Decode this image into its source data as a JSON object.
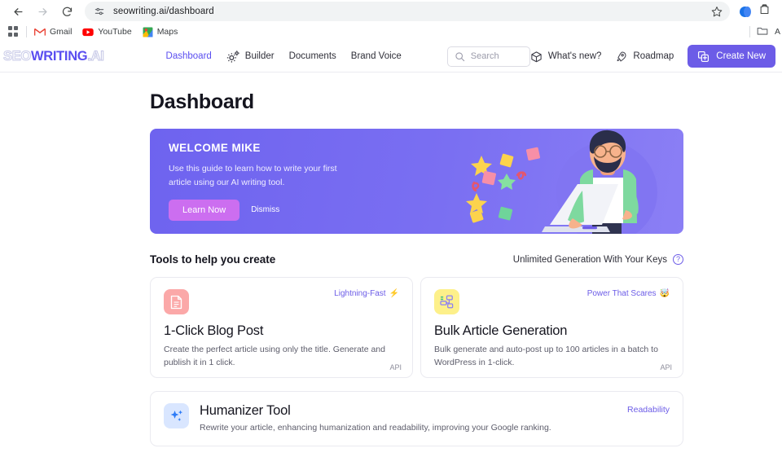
{
  "browser": {
    "url": "seowriting.ai/dashboard",
    "back_icon": "back-arrow-icon",
    "forward_icon": "forward-arrow-icon",
    "reload_icon": "reload-icon",
    "site_settings_icon": "site-settings-icon",
    "star_icon": "bookmark-star-icon",
    "bookmarks": [
      {
        "label": "Gmail",
        "icon": "gmail-icon"
      },
      {
        "label": "YouTube",
        "icon": "youtube-icon"
      },
      {
        "label": "Maps",
        "icon": "maps-icon"
      }
    ]
  },
  "header": {
    "logo": {
      "part1": "SEO",
      "part2": "WRITING",
      "part3": ".AI"
    },
    "nav": [
      {
        "label": "Dashboard",
        "active": true,
        "icon": null
      },
      {
        "label": "Builder",
        "active": false,
        "icon": "gears-icon"
      },
      {
        "label": "Documents",
        "active": false,
        "icon": null
      },
      {
        "label": "Brand Voice",
        "active": false,
        "icon": null
      }
    ],
    "search": {
      "placeholder": "Search",
      "value": "",
      "icon": "search-icon"
    },
    "right_links": [
      {
        "label": "What's new?",
        "icon": "gift-box-icon"
      },
      {
        "label": "Roadmap",
        "icon": "rocket-icon"
      }
    ],
    "create_button": {
      "label": "Create New",
      "icon": "create-new-icon"
    }
  },
  "page": {
    "title": "Dashboard"
  },
  "banner": {
    "title": "WELCOME MIKE",
    "subtitle": "Use this guide to learn how to write your first article using our AI writing tool.",
    "primary_button": "Learn Now",
    "secondary_button": "Dismiss",
    "illustration": "person-with-laptop-illustration",
    "gradient_from": "#6e63ef",
    "gradient_to": "#8b7ff5",
    "primary_button_color": "#cc6ef0"
  },
  "tools": {
    "heading": "Tools to help you create",
    "keys_label": "Unlimited Generation With Your Keys",
    "help_icon": "question-mark-icon",
    "cards": [
      {
        "title": "1-Click Blog Post",
        "description": "Create the perfect article using only the title. Generate and publish it in 1 click.",
        "tag": "Lightning-Fast",
        "tag_emoji": "⚡",
        "footer": "API",
        "icon": "document-icon",
        "icon_bg": "#fba8a8",
        "icon_color": "#ffffff"
      },
      {
        "title": "Bulk Article Generation",
        "description": "Bulk generate and auto-post up to 100 articles in a batch to WordPress in 1-click.",
        "tag": "Power That Scares",
        "tag_emoji": "🤯",
        "footer": "API",
        "icon": "workflow-nodes-icon",
        "icon_bg": "#fdf08a",
        "icon_color": "#8b7ff5"
      }
    ],
    "wide_card": {
      "title": "Humanizer Tool",
      "description": "Rewrite your article, enhancing humanization and readability, improving your Google ranking.",
      "tag": "Readability",
      "icon": "sparkles-icon",
      "icon_bg": "#d9e6ff",
      "icon_color": "#2d7bf7"
    }
  }
}
